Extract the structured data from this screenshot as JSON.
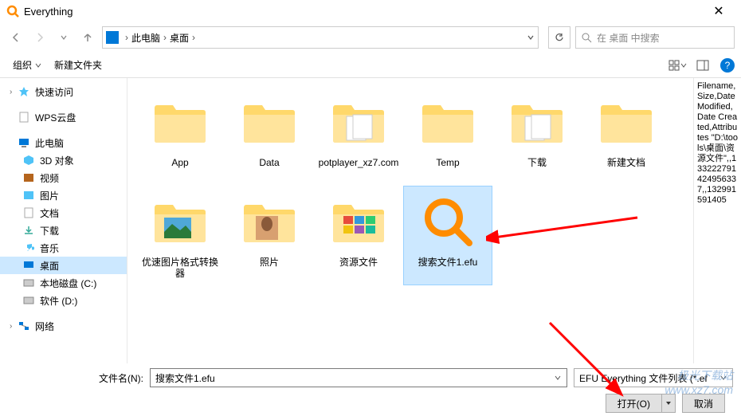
{
  "window": {
    "title": "Everything"
  },
  "breadcrumb": {
    "root": "此电脑",
    "current": "桌面"
  },
  "search": {
    "placeholder": "在 桌面 中搜索"
  },
  "toolbar": {
    "organize": "组织",
    "newfolder": "新建文件夹"
  },
  "sidebar": {
    "quick": "快速访问",
    "wps": "WPS云盘",
    "thispc": "此电脑",
    "objects3d": "3D 对象",
    "videos": "视频",
    "pictures": "图片",
    "documents": "文档",
    "downloads": "下载",
    "music": "音乐",
    "desktop": "桌面",
    "drivec": "本地磁盘 (C:)",
    "drived": "软件 (D:)",
    "network": "网络"
  },
  "files": [
    {
      "name": "App",
      "type": "folder"
    },
    {
      "name": "Data",
      "type": "folder"
    },
    {
      "name": "potplayer_xz7.com",
      "type": "folder-doc"
    },
    {
      "name": "Temp",
      "type": "folder"
    },
    {
      "name": "下载",
      "type": "folder-doc"
    },
    {
      "name": "新建文档",
      "type": "folder"
    },
    {
      "name": "优速图片格式转换器",
      "type": "folder-img1"
    },
    {
      "name": "照片",
      "type": "folder-img2"
    },
    {
      "name": "资源文件",
      "type": "folder-thumbs"
    },
    {
      "name": "搜索文件1.efu",
      "type": "efu",
      "selected": true
    }
  ],
  "preview": "Filename,Size,Date Modified,Date Created,Attributes\n\"D:\\tools\\桌面\\资源文件\",,133222791424956337,,132991591405",
  "filename": {
    "label": "文件名(N):",
    "value": "搜索文件1.efu"
  },
  "filetype": {
    "value": "EFU Everything 文件列表 (*.ef"
  },
  "buttons": {
    "open": "打开(O)",
    "cancel": "取消"
  },
  "watermark": "极光下载站\nwww.xz7.com"
}
